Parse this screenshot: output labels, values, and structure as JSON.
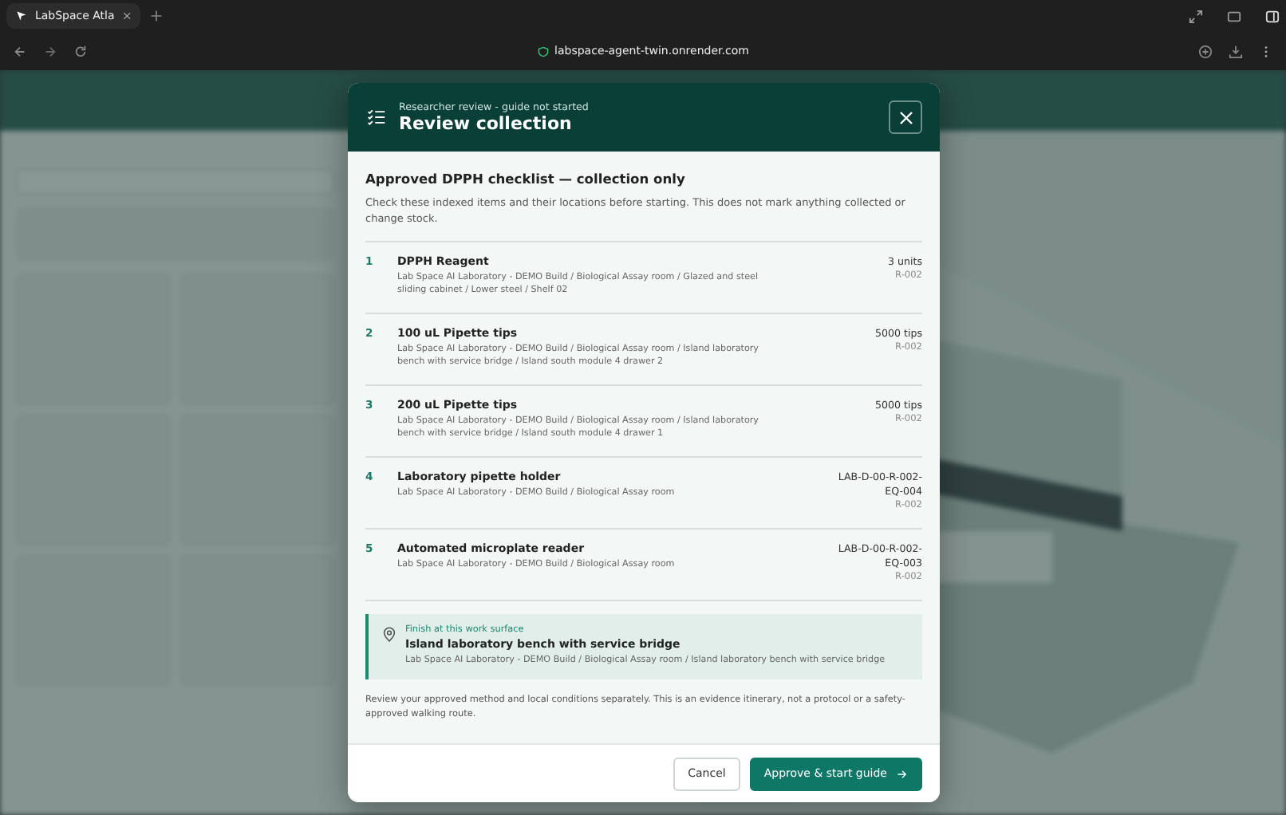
{
  "browser": {
    "tab_title": "LabSpace Atla",
    "url": "labspace-agent-twin.onrender.com"
  },
  "dialog": {
    "eyebrow": "Researcher review - guide not started",
    "title": "Review collection",
    "heading": "Approved DPPH checklist — collection only",
    "intro": "Check these indexed items and their locations before starting. This does not mark anything collected or change stock.",
    "items": [
      {
        "number": "1",
        "name": "DPPH Reagent",
        "location": "Lab Space AI Laboratory - DEMO Build / Biological Assay room / Glazed and steel sliding cabinet / Lower steel / Shelf 02",
        "quantity": "3 units",
        "room": "R-002"
      },
      {
        "number": "2",
        "name": "100 uL Pipette tips",
        "location": "Lab Space AI Laboratory - DEMO Build / Biological Assay room / Island laboratory bench with service bridge / Island south module 4 drawer 2",
        "quantity": "5000 tips",
        "room": "R-002"
      },
      {
        "number": "3",
        "name": "200 uL Pipette tips",
        "location": "Lab Space AI Laboratory - DEMO Build / Biological Assay room / Island laboratory bench with service bridge / Island south module 4 drawer 1",
        "quantity": "5000 tips",
        "room": "R-002"
      },
      {
        "number": "4",
        "name": "Laboratory pipette holder",
        "location": "Lab Space AI Laboratory - DEMO Build / Biological Assay room",
        "quantity": "LAB-D-00-R-002-EQ-004",
        "room": "R-002"
      },
      {
        "number": "5",
        "name": "Automated microplate reader",
        "location": "Lab Space AI Laboratory - DEMO Build / Biological Assay room",
        "quantity": "LAB-D-00-R-002-EQ-003",
        "room": "R-002"
      }
    ],
    "finish": {
      "label": "Finish at this work surface",
      "name": "Island laboratory bench with service bridge",
      "location": "Lab Space AI Laboratory - DEMO Build / Biological Assay room / Island laboratory bench with service bridge"
    },
    "note": "Review your approved method and local conditions separately. This is an evidence itinerary, not a protocol or a safety-approved walking route.",
    "buttons": [
      {
        "label": "Cancel",
        "kind": "secondary"
      },
      {
        "label": "Approve & start guide",
        "kind": "primary"
      }
    ]
  }
}
